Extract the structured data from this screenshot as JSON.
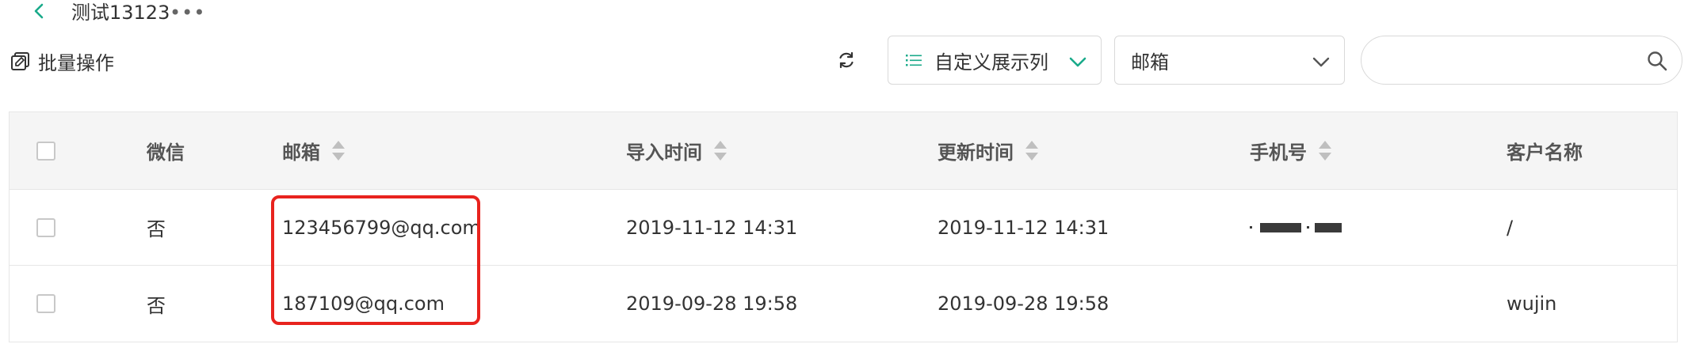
{
  "header": {
    "title": "测试13123",
    "more": "•••"
  },
  "toolbar": {
    "batch_label": "批量操作",
    "custom_columns_label": "自定义展示列",
    "field_select_value": "邮箱",
    "search_placeholder": ""
  },
  "table": {
    "columns": [
      "微信",
      "邮箱",
      "导入时间",
      "更新时间",
      "手机号",
      "客户名称"
    ],
    "rows": [
      {
        "wechat": "否",
        "email": "123456799@qq.com",
        "import_time": "2019-11-12 14:31",
        "update_time": "2019-11-12 14:31",
        "phone": "(redacted)",
        "customer_name": "/"
      },
      {
        "wechat": "否",
        "email": "187109@qq.com",
        "import_time": "2019-09-28 19:58",
        "update_time": "2019-09-28 19:58",
        "phone": "",
        "customer_name": "wujin"
      }
    ]
  },
  "colors": {
    "accent": "#1aaa8a",
    "highlight": "#e8231e",
    "header_bg": "#f5f5f5"
  },
  "icons": [
    "back-arrow-icon",
    "more-icon",
    "batch-edit-icon",
    "refresh-icon",
    "list-icon",
    "chevron-down-icon",
    "search-icon",
    "sort-icon"
  ]
}
